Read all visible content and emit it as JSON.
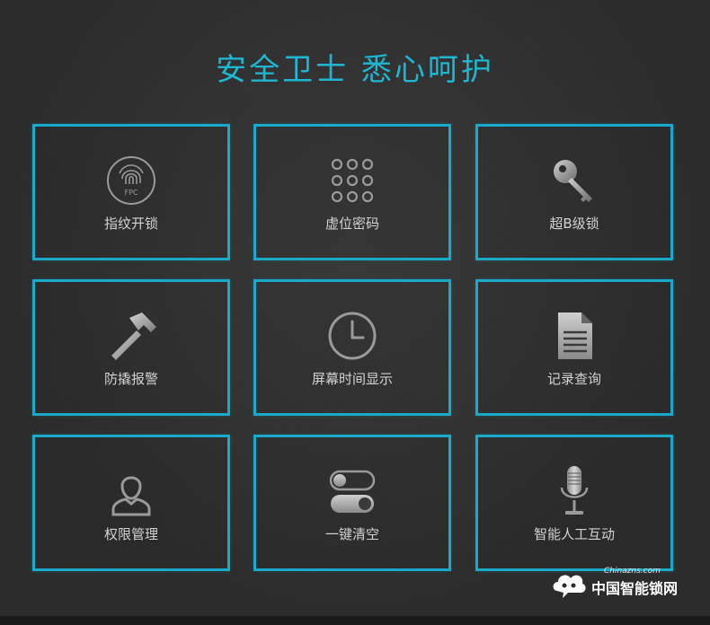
{
  "title": "安全卫士 悉心呵护",
  "features": [
    {
      "label": "指纹开锁",
      "icon": "fingerprint-icon",
      "icon_text": "FPC"
    },
    {
      "label": "虚位密码",
      "icon": "keypad-icon"
    },
    {
      "label": "超B级锁",
      "icon": "key-icon"
    },
    {
      "label": "防撬报警",
      "icon": "hammer-icon"
    },
    {
      "label": "屏幕时间显示",
      "icon": "clock-icon"
    },
    {
      "label": "记录查询",
      "icon": "document-icon"
    },
    {
      "label": "权限管理",
      "icon": "user-icon"
    },
    {
      "label": "一键清空",
      "icon": "toggle-icon"
    },
    {
      "label": "智能人工互动",
      "icon": "microphone-icon"
    }
  ],
  "watermark": {
    "small_text": "Chinazns.com",
    "text": "中国智能锁网"
  },
  "colors": {
    "accent": "#19a9c9",
    "title": "#1fb6d2",
    "background": "#2c2c2c",
    "label": "#d2d2d2"
  }
}
